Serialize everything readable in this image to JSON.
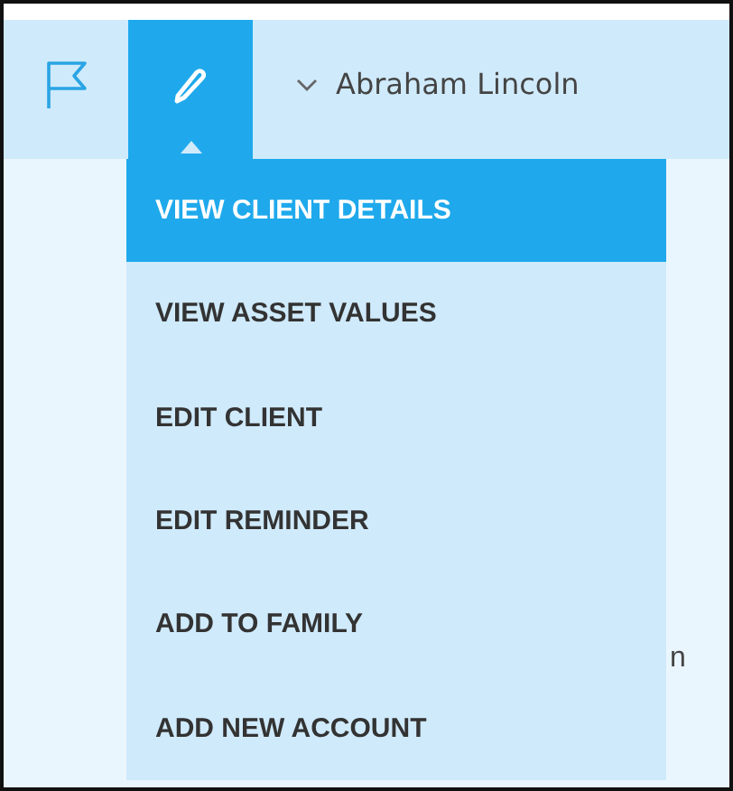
{
  "toolbar": {
    "tabs": [
      {
        "kind": "flag",
        "selected": false
      },
      {
        "kind": "edit",
        "selected": true
      }
    ],
    "client_name": "Abraham Lincoln"
  },
  "menu": {
    "items": [
      {
        "label": "VIEW CLIENT DETAILS",
        "selected": true
      },
      {
        "label": "VIEW ASSET VALUES",
        "selected": false
      },
      {
        "label": "EDIT CLIENT",
        "selected": false
      },
      {
        "label": "EDIT REMINDER",
        "selected": false
      },
      {
        "label": "ADD TO FAMILY",
        "selected": false
      },
      {
        "label": "ADD NEW ACCOUNT",
        "selected": false
      }
    ]
  },
  "background_text": "n"
}
